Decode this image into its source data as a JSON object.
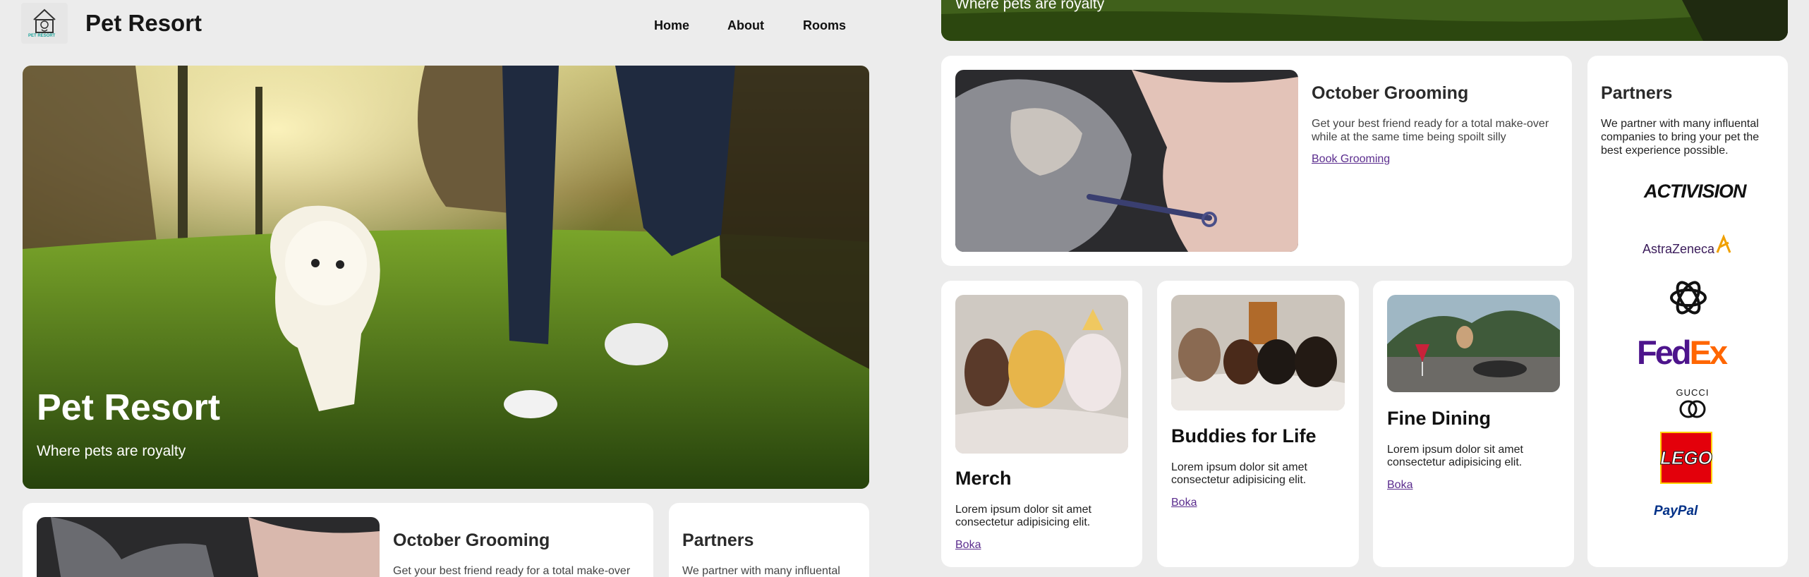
{
  "site": {
    "brand": "Pet Resort",
    "logo_text": "PET RESORT"
  },
  "nav": {
    "home": "Home",
    "about": "About",
    "rooms": "Rooms"
  },
  "hero": {
    "title": "Pet Resort",
    "subtitle": "Where pets are royalty"
  },
  "grooming": {
    "title": "October Grooming",
    "text": "Get your best friend ready for a total make-over while at the same time being spoilt silly",
    "link": "Book Grooming"
  },
  "partners": {
    "title": "Partners",
    "text": "We partner with many influental companies to bring your pet the best experience possible.",
    "text_truncated": "We partner with many influental",
    "logos": [
      {
        "name": "activision-logo",
        "label": "ACTIVISION"
      },
      {
        "name": "astrazeneca-logo",
        "label": "AstraZeneca"
      },
      {
        "name": "openai-logo",
        "label": ""
      },
      {
        "name": "fedex-logo",
        "label": "FedEx"
      },
      {
        "name": "gucci-logo",
        "label": "GUCCI"
      },
      {
        "name": "lego-logo",
        "label": "LEGO"
      },
      {
        "name": "paypal-logo",
        "label": "PayPal"
      }
    ]
  },
  "features": [
    {
      "title": "Merch",
      "text": "Lorem ipsum dolor sit amet consectetur adipisicing elit.",
      "link": "Boka"
    },
    {
      "title": "Buddies for Life",
      "text": "Lorem ipsum dolor sit amet consectetur adipisicing elit.",
      "link": "Boka"
    },
    {
      "title": "Fine Dining",
      "text": "Lorem ipsum dolor sit amet consectetur adipisicing elit.",
      "link": "Boka"
    }
  ],
  "colors": {
    "background": "#ececec",
    "card": "#ffffff",
    "link": "#5b2d8e",
    "fedex_purple": "#4d148c",
    "fedex_orange": "#ff6600",
    "lego_red": "#e3000b",
    "paypal_blue": "#003087"
  }
}
